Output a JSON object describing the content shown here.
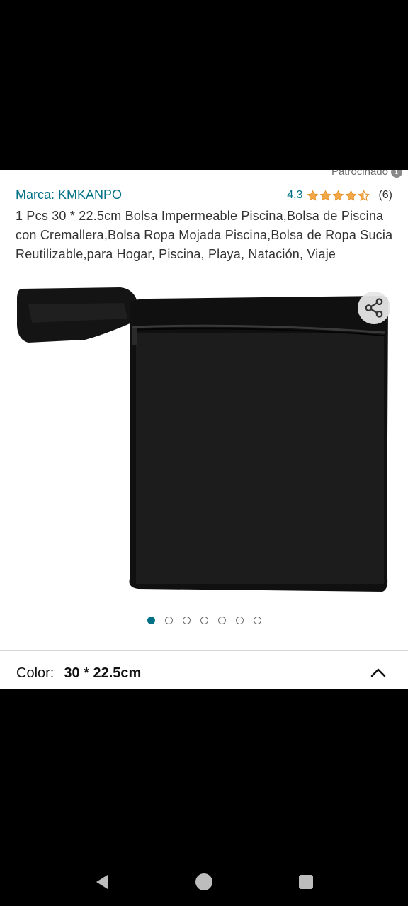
{
  "sponsored": {
    "label": "Patrocinado",
    "info_icon": "i"
  },
  "product": {
    "brand": "Marca: KMKANPO",
    "rating_value": "4,3",
    "rating": 4.3,
    "rating_count": "(6)",
    "title": "1 Pcs 30 * 22.5cm Bolsa Impermeable Piscina,Bolsa de Piscina con Cremallera,Bolsa Ropa Mojada Piscina,Bolsa de Ropa Sucia Reutilizable,para Hogar, Piscina, Playa, Natación, Viaje"
  },
  "carousel": {
    "total": 7,
    "active_index": 0
  },
  "color": {
    "label": "Color:",
    "value": "30 * 22.5cm"
  },
  "colors": {
    "link": "#007185",
    "star": "#f3a847",
    "text": "#333333"
  },
  "icons": {
    "share": "share-icon",
    "chevron": "chevron-up-icon",
    "back": "back-icon",
    "home": "home-icon",
    "recent": "recent-apps-icon"
  }
}
